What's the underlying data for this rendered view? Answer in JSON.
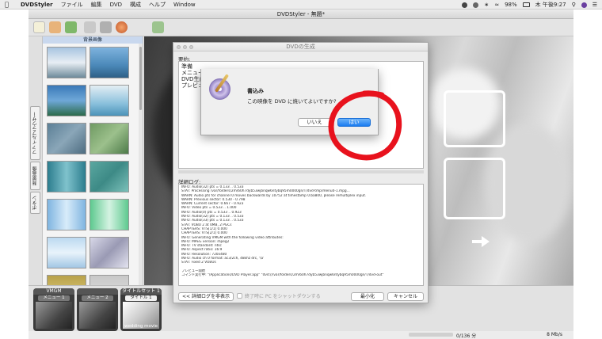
{
  "menubar": {
    "apple": "",
    "app_name": "DVDStyler",
    "items": [
      "ファイル",
      "編集",
      "DVD",
      "構成",
      "ヘルプ",
      "Window"
    ],
    "battery": "98%",
    "clock": "木 午後9:27"
  },
  "window": {
    "title": "DVDStyler - 無題*"
  },
  "thumbnails": {
    "header": "背景画像"
  },
  "left_tabs": [
    "ファイルブラウザー",
    "背景画像",
    "ボタン"
  ],
  "menus": [
    {
      "top_label": "VMGM",
      "label": "メニュー 1"
    },
    {
      "top_label": "",
      "label": "メニュー 2"
    },
    {
      "top_label": "タイトルセット 1",
      "label": "タイトル 1",
      "caption": "wedding movie"
    }
  ],
  "status": {
    "size": "0/136 分",
    "rate": "8 Mb/s"
  },
  "dialog": {
    "title": "DVDの生成",
    "summary_label": "要約:",
    "summary_lines": [
      "準備",
      "メニュー",
      "DVD生成",
      "プレビュー"
    ],
    "log_label": "詳細ログ:",
    "log_lines": [
      "INFO: Audio(32) pts = 0.133 .. 0.533",
      "STAT: Processing /var/folders/2m/60h7dyb53wjbnqw6ntybq95m0000gn/T/dvd-tmp/menu0-1.mpg...",
      "WARN: Audio pts for channel 0 moves backwards by 10752 at timestamp 0.ba800, please remultiplex input.",
      "WARN: Previous sector: 0.530 - 0.798",
      "WARN: Current sector: 0.667 - 0.923",
      "INFO: Video pts = 0.533 .. 1.000",
      "INFO: Audio(0) pts = 0.533 .. 0.923",
      "INFO: Audio(32) pts = 0.133 .. 0.533",
      "INFO: Audio(33) pts = 0.133 .. 0.533",
      "STAT: VOBU 2 at 0MB, 2 PGCs",
      "CHAPTERS: VTS[1/1] 0.000",
      "CHAPTERS: VTS[2/1] 0.000",
      "INFO: Generating VMGM with the following video attributes:",
      "INFO: MPEG version: mpeg2",
      "INFO: TV standard: ntsc",
      "INFO: Aspect ratio: 16:9",
      "INFO: Resolution: 720x480",
      "INFO: Audio ch 0 format: ac3/2ch, 48khz drc, '\\a'",
      "STAT: Fixed 2 VOBUs",
      "",
      "プレビュー開始",
      "コマンド実行中: \"/Applications/DVD Player.app\" \"dvd:///var/folders/2m/60h7dyb53wjbnqw6ntybq95m0000gn/T/dvd-out\""
    ],
    "hide_log_btn": "<< 詳細ログを非表示",
    "shutdown_check": "終了時に PC をシャットダウンする",
    "minimize_btn": "最小化",
    "cancel_btn": "キャンセル"
  },
  "confirm": {
    "title": "書込み",
    "message": "この映像を DVD に焼いてよいですか?",
    "no_btn": "いいえ",
    "yes_btn": "はい"
  },
  "colors": {
    "accent": "#1a7cf0",
    "annotation": "#e8121d"
  }
}
